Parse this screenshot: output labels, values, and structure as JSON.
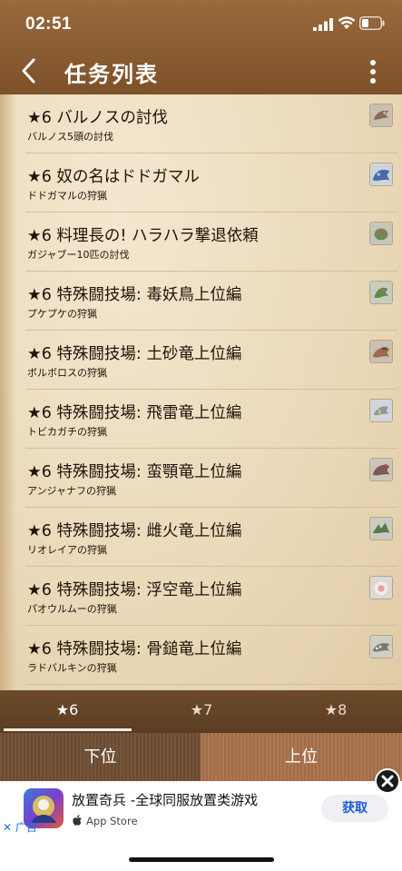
{
  "status_bar": {
    "time": "02:51"
  },
  "nav": {
    "title": "任务列表"
  },
  "quests": [
    {
      "title": "★6 バルノスの討伐",
      "subtitle": "バルノス5頭の討伐",
      "icon": "barnos-monster-icon"
    },
    {
      "title": "★6 奴の名はドドガマル",
      "subtitle": "ドドガマルの狩猟",
      "icon": "dodogama-monster-icon"
    },
    {
      "title": "★6 料理長の! ハラハラ撃退依頼",
      "subtitle": "ガジャブー10匹の討伐",
      "icon": "gajabu-monster-icon"
    },
    {
      "title": "★6 特殊闘技場: 毒妖鳥上位編",
      "subtitle": "プケプケの狩猟",
      "icon": "pukei-pukei-monster-icon"
    },
    {
      "title": "★6 特殊闘技場: 土砂竜上位編",
      "subtitle": "ボルボロスの狩猟",
      "icon": "barroth-monster-icon"
    },
    {
      "title": "★6 特殊闘技場: 飛雷竜上位編",
      "subtitle": "トビカガチの狩猟",
      "icon": "tobi-kadachi-monster-icon"
    },
    {
      "title": "★6 特殊闘技場: 蛮顎竜上位編",
      "subtitle": "アンジャナフの狩猟",
      "icon": "anjanath-monster-icon"
    },
    {
      "title": "★6 特殊闘技場: 雌火竜上位編",
      "subtitle": "リオレイアの狩猟",
      "icon": "rathian-monster-icon"
    },
    {
      "title": "★6 特殊闘技場: 浮空竜上位編",
      "subtitle": "パオウルムーの狩猟",
      "icon": "paolumu-monster-icon"
    },
    {
      "title": "★6 特殊闘技場: 骨鎚竜上位編",
      "subtitle": "ラドバルキンの狩猟",
      "icon": "radobaan-monster-icon"
    }
  ],
  "rank_tabs": [
    {
      "label": "★6",
      "active": true
    },
    {
      "label": "★7",
      "active": false
    },
    {
      "label": "★8",
      "active": false
    }
  ],
  "rank_toggle": {
    "low": "下位",
    "high": "上位"
  },
  "ad": {
    "title": "放置奇兵 -全球同服放置类游戏",
    "store": "App Store",
    "get_label": "获取",
    "ad_label": "广告"
  },
  "colors": {
    "header_brown": "#8a5c32",
    "parchment": "#ead9b8",
    "tab_bar": "#5c3d22",
    "low_button": "#6f4f34",
    "high_button": "#a8704a",
    "ad_button_text": "#1c5bd8"
  }
}
